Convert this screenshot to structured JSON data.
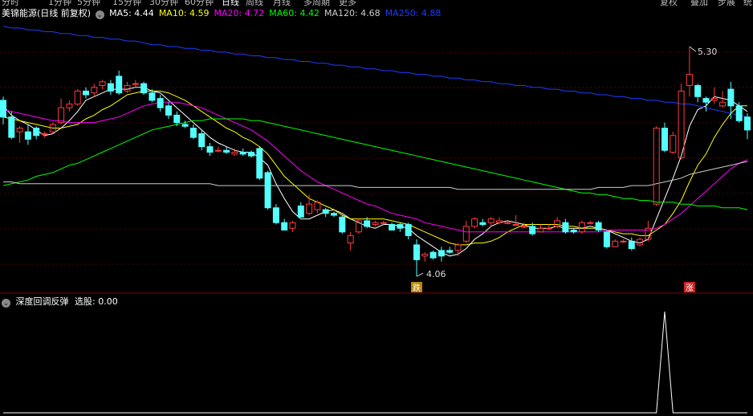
{
  "top_tabs": [
    "分时",
    "1分钟",
    "5分钟",
    "15分钟",
    "30分钟",
    "60分钟",
    "日线",
    "周线",
    "月线",
    "多周期",
    "更多"
  ],
  "active_tab": "日线",
  "top_buttons": [
    "复权",
    "叠加",
    "步展",
    "统"
  ],
  "stock_title": "美锦能源(日线 前复权)",
  "ma_legend": [
    {
      "label": "MA5: 4.44",
      "color": "#ffffff"
    },
    {
      "label": "MA10: 4.59",
      "color": "#ffff00"
    },
    {
      "label": "MA20: 4.72",
      "color": "#ff00ff"
    },
    {
      "label": "MA60: 4.42",
      "color": "#00ff00"
    },
    {
      "label": "MA120: 4.68",
      "color": "#cccccc"
    },
    {
      "label": "MA250: 4.88",
      "color": "#1c3cff"
    }
  ],
  "indicator_title": "深度回调反弹",
  "indicator_value": "选股: 0.00",
  "chart_data": {
    "type": "candlestick",
    "ylim": [
      4.0,
      5.43
    ],
    "high_annotation": "5.30",
    "low_annotation": "4.06",
    "markers": [
      "跌",
      "涨"
    ],
    "candles": [
      [
        5.01,
        4.92,
        5.03,
        4.88
      ],
      [
        4.92,
        4.81,
        4.95,
        4.8
      ],
      [
        4.84,
        4.86,
        4.87,
        4.78
      ],
      [
        4.84,
        4.8,
        4.88,
        4.77
      ],
      [
        4.86,
        4.82,
        4.87,
        4.8
      ],
      [
        4.83,
        4.83,
        4.84,
        4.81
      ],
      [
        4.84,
        4.88,
        4.89,
        4.83
      ],
      [
        4.89,
        4.97,
        5.02,
        4.88
      ],
      [
        4.97,
        4.99,
        5.01,
        4.95
      ],
      [
        4.99,
        5.06,
        5.07,
        4.98
      ],
      [
        5.06,
        5.04,
        5.08,
        5.02
      ],
      [
        5.05,
        5.08,
        5.1,
        5.03
      ],
      [
        5.09,
        5.11,
        5.12,
        5.07
      ],
      [
        5.1,
        5.06,
        5.12,
        5.04
      ],
      [
        5.14,
        5.05,
        5.17,
        5.04
      ],
      [
        5.06,
        5.09,
        5.11,
        5.05
      ],
      [
        5.1,
        5.1,
        5.12,
        5.08
      ],
      [
        5.1,
        5.05,
        5.11,
        5.04
      ],
      [
        5.05,
        5.01,
        5.07,
        5.0
      ],
      [
        5.02,
        4.97,
        5.04,
        4.95
      ],
      [
        4.98,
        4.93,
        5.0,
        4.91
      ],
      [
        4.93,
        4.89,
        4.95,
        4.87
      ],
      [
        4.88,
        4.87,
        4.9,
        4.86
      ],
      [
        4.86,
        4.81,
        4.88,
        4.8
      ],
      [
        4.83,
        4.76,
        4.85,
        4.74
      ],
      [
        4.76,
        4.73,
        4.78,
        4.71
      ],
      [
        4.74,
        4.74,
        4.76,
        4.73
      ],
      [
        4.74,
        4.73,
        4.76,
        4.72
      ],
      [
        4.72,
        4.73,
        4.75,
        4.71
      ],
      [
        4.73,
        4.72,
        4.75,
        4.71
      ],
      [
        4.73,
        4.71,
        4.74,
        4.7
      ],
      [
        4.75,
        4.59,
        4.76,
        4.58
      ],
      [
        4.62,
        4.43,
        4.63,
        4.42
      ],
      [
        4.43,
        4.35,
        4.45,
        4.34
      ],
      [
        4.35,
        4.31,
        4.37,
        4.31
      ],
      [
        4.32,
        4.35,
        4.36,
        4.3
      ],
      [
        4.44,
        4.38,
        4.46,
        4.38
      ],
      [
        4.4,
        4.45,
        4.5,
        4.39
      ],
      [
        4.42,
        4.46,
        4.47,
        4.4
      ],
      [
        4.42,
        4.4,
        4.43,
        4.38
      ],
      [
        4.4,
        4.39,
        4.41,
        4.38
      ],
      [
        4.38,
        4.3,
        4.39,
        4.29
      ],
      [
        4.24,
        4.28,
        4.3,
        4.2
      ],
      [
        4.3,
        4.36,
        4.37,
        4.29
      ],
      [
        4.36,
        4.33,
        4.38,
        4.32
      ],
      [
        4.34,
        4.35,
        4.36,
        4.33
      ],
      [
        4.35,
        4.35,
        4.36,
        4.34
      ],
      [
        4.34,
        4.31,
        4.35,
        4.31
      ],
      [
        4.34,
        4.32,
        4.35,
        4.3
      ],
      [
        4.34,
        4.28,
        4.35,
        4.26
      ],
      [
        4.23,
        4.15,
        4.26,
        4.06
      ],
      [
        4.17,
        4.18,
        4.19,
        4.14
      ],
      [
        4.19,
        4.16,
        4.2,
        4.15
      ],
      [
        4.2,
        4.17,
        4.22,
        4.14
      ],
      [
        4.2,
        4.19,
        4.22,
        4.18
      ],
      [
        4.2,
        4.23,
        4.24,
        4.17
      ],
      [
        4.25,
        4.33,
        4.36,
        4.24
      ],
      [
        4.33,
        4.37,
        4.38,
        4.32
      ],
      [
        4.35,
        4.34,
        4.37,
        4.33
      ],
      [
        4.35,
        4.37,
        4.38,
        4.33
      ],
      [
        4.35,
        4.36,
        4.38,
        4.34
      ],
      [
        4.35,
        4.35,
        4.36,
        4.34
      ],
      [
        4.34,
        4.34,
        4.39,
        4.34
      ],
      [
        4.33,
        4.33,
        4.35,
        4.32
      ],
      [
        4.33,
        4.29,
        4.35,
        4.28
      ],
      [
        4.3,
        4.32,
        4.34,
        4.3
      ],
      [
        4.32,
        4.32,
        4.34,
        4.31
      ],
      [
        4.33,
        4.36,
        4.38,
        4.32
      ],
      [
        4.35,
        4.3,
        4.37,
        4.29
      ],
      [
        4.31,
        4.3,
        4.32,
        4.29
      ],
      [
        4.3,
        4.35,
        4.36,
        4.29
      ],
      [
        4.35,
        4.35,
        4.36,
        4.34
      ],
      [
        4.35,
        4.31,
        4.36,
        4.3
      ],
      [
        4.3,
        4.22,
        4.31,
        4.21
      ],
      [
        4.22,
        4.25,
        4.26,
        4.22
      ],
      [
        4.25,
        4.25,
        4.26,
        4.24
      ],
      [
        4.25,
        4.21,
        4.27,
        4.2
      ],
      [
        4.23,
        4.26,
        4.27,
        4.22
      ],
      [
        4.26,
        4.32,
        4.36,
        4.25
      ],
      [
        4.45,
        4.86,
        4.87,
        4.44
      ],
      [
        4.86,
        4.74,
        4.89,
        4.73
      ],
      [
        4.73,
        4.82,
        4.84,
        4.72
      ],
      [
        4.7,
        5.06,
        5.1,
        4.69
      ],
      [
        5.09,
        5.15,
        5.3,
        5.03
      ],
      [
        5.09,
        5.03,
        5.1,
        5.0
      ],
      [
        5.02,
        5.0,
        5.03,
        4.95
      ],
      [
        5.01,
        5.02,
        5.08,
        4.99
      ],
      [
        4.98,
        5.0,
        5.06,
        4.97
      ],
      [
        5.07,
        4.98,
        5.11,
        4.91
      ],
      [
        4.98,
        4.9,
        5.0,
        4.89
      ],
      [
        4.92,
        4.85,
        4.94,
        4.8
      ]
    ],
    "ma_lines": {
      "MA5": [
        4.98,
        4.93,
        4.9,
        4.88,
        4.85,
        4.82,
        4.83,
        4.86,
        4.9,
        4.95,
        5.01,
        5.03,
        5.05,
        5.07,
        5.07,
        5.07,
        5.08,
        5.08,
        5.06,
        5.05,
        5.01,
        4.97,
        4.93,
        4.89,
        4.85,
        4.81,
        4.78,
        4.76,
        4.74,
        4.73,
        4.73,
        4.7,
        4.66,
        4.56,
        4.48,
        4.41,
        4.37,
        4.37,
        4.39,
        4.41,
        4.42,
        4.4,
        4.37,
        4.35,
        4.33,
        4.32,
        4.34,
        4.34,
        4.33,
        4.32,
        4.28,
        4.25,
        4.22,
        4.19,
        4.17,
        4.18,
        4.21,
        4.26,
        4.29,
        4.33,
        4.35,
        4.36,
        4.35,
        4.34,
        4.32,
        4.32,
        4.32,
        4.33,
        4.32,
        4.32,
        4.32,
        4.33,
        4.32,
        4.31,
        4.29,
        4.27,
        4.25,
        4.24,
        4.26,
        4.37,
        4.48,
        4.59,
        4.71,
        4.87,
        4.96,
        4.98,
        5.03,
        5.02,
        5.01,
        4.98,
        4.95
      ],
      "MA10": [
        4.92,
        4.91,
        4.9,
        4.89,
        4.88,
        4.87,
        4.86,
        4.86,
        4.87,
        4.88,
        4.91,
        4.93,
        4.96,
        4.98,
        5.01,
        5.04,
        5.05,
        5.06,
        5.06,
        5.06,
        5.05,
        5.03,
        5.01,
        4.98,
        4.95,
        4.92,
        4.89,
        4.86,
        4.84,
        4.81,
        4.79,
        4.76,
        4.72,
        4.66,
        4.6,
        4.56,
        4.52,
        4.48,
        4.46,
        4.44,
        4.42,
        4.39,
        4.37,
        4.37,
        4.37,
        4.37,
        4.37,
        4.36,
        4.35,
        4.34,
        4.32,
        4.3,
        4.28,
        4.26,
        4.24,
        4.23,
        4.23,
        4.24,
        4.24,
        4.25,
        4.27,
        4.3,
        4.32,
        4.34,
        4.34,
        4.34,
        4.34,
        4.34,
        4.33,
        4.33,
        4.32,
        4.32,
        4.32,
        4.31,
        4.3,
        4.29,
        4.29,
        4.28,
        4.28,
        4.31,
        4.34,
        4.4,
        4.47,
        4.57,
        4.66,
        4.72,
        4.81,
        4.88,
        4.94,
        4.98,
        4.98
      ],
      "MA20": [
        4.96,
        4.95,
        4.94,
        4.93,
        4.92,
        4.91,
        4.9,
        4.9,
        4.89,
        4.89,
        4.89,
        4.89,
        4.9,
        4.91,
        4.92,
        4.94,
        4.96,
        4.98,
        4.99,
        5.0,
        5.0,
        5.0,
        4.99,
        4.98,
        4.97,
        4.95,
        4.93,
        4.91,
        4.89,
        4.87,
        4.85,
        4.82,
        4.79,
        4.75,
        4.71,
        4.67,
        4.63,
        4.6,
        4.57,
        4.55,
        4.53,
        4.51,
        4.49,
        4.47,
        4.45,
        4.44,
        4.42,
        4.4,
        4.39,
        4.38,
        4.37,
        4.35,
        4.34,
        4.33,
        4.32,
        4.31,
        4.3,
        4.3,
        4.3,
        4.3,
        4.3,
        4.3,
        4.3,
        4.3,
        4.3,
        4.3,
        4.3,
        4.3,
        4.3,
        4.3,
        4.3,
        4.3,
        4.3,
        4.31,
        4.31,
        4.31,
        4.31,
        4.31,
        4.31,
        4.32,
        4.34,
        4.37,
        4.4,
        4.44,
        4.48,
        4.52,
        4.56,
        4.6,
        4.64,
        4.67,
        4.69
      ],
      "MA60": [
        4.55,
        4.56,
        4.57,
        4.58,
        4.6,
        4.61,
        4.62,
        4.64,
        4.66,
        4.67,
        4.69,
        4.71,
        4.73,
        4.75,
        4.77,
        4.79,
        4.81,
        4.83,
        4.85,
        4.86,
        4.87,
        4.88,
        4.89,
        4.9,
        4.9,
        4.91,
        4.91,
        4.91,
        4.91,
        4.91,
        4.9,
        4.9,
        4.89,
        4.88,
        4.87,
        4.86,
        4.85,
        4.84,
        4.83,
        4.82,
        4.81,
        4.8,
        4.79,
        4.78,
        4.77,
        4.76,
        4.75,
        4.74,
        4.73,
        4.72,
        4.71,
        4.7,
        4.69,
        4.68,
        4.67,
        4.66,
        4.65,
        4.64,
        4.63,
        4.62,
        4.61,
        4.6,
        4.59,
        4.58,
        4.57,
        4.56,
        4.55,
        4.54,
        4.53,
        4.52,
        4.51,
        4.51,
        4.5,
        4.5,
        4.49,
        4.48,
        4.48,
        4.47,
        4.47,
        4.46,
        4.46,
        4.46,
        4.45,
        4.45,
        4.44,
        4.44,
        4.44,
        4.43,
        4.43,
        4.43,
        4.42
      ],
      "MA120": [
        4.57,
        4.57,
        4.56,
        4.56,
        4.56,
        4.56,
        4.56,
        4.56,
        4.56,
        4.56,
        4.56,
        4.56,
        4.56,
        4.56,
        4.56,
        4.56,
        4.56,
        4.56,
        4.56,
        4.56,
        4.56,
        4.56,
        4.56,
        4.56,
        4.56,
        4.56,
        4.55,
        4.55,
        4.55,
        4.55,
        4.55,
        4.55,
        4.55,
        4.55,
        4.55,
        4.55,
        4.55,
        4.55,
        4.55,
        4.55,
        4.55,
        4.55,
        4.55,
        4.54,
        4.54,
        4.54,
        4.54,
        4.54,
        4.54,
        4.54,
        4.54,
        4.54,
        4.54,
        4.54,
        4.54,
        4.53,
        4.53,
        4.53,
        4.53,
        4.53,
        4.53,
        4.53,
        4.53,
        4.53,
        4.53,
        4.53,
        4.53,
        4.53,
        4.53,
        4.53,
        4.53,
        4.53,
        4.54,
        4.54,
        4.54,
        4.54,
        4.55,
        4.55,
        4.55,
        4.56,
        4.57,
        4.58,
        4.59,
        4.61,
        4.62,
        4.63,
        4.64,
        4.65,
        4.66,
        4.67,
        4.68
      ],
      "MA250": [
        5.41,
        5.4,
        5.4,
        5.39,
        5.39,
        5.38,
        5.38,
        5.37,
        5.37,
        5.36,
        5.36,
        5.35,
        5.35,
        5.34,
        5.34,
        5.33,
        5.33,
        5.32,
        5.31,
        5.31,
        5.3,
        5.3,
        5.29,
        5.29,
        5.28,
        5.28,
        5.27,
        5.27,
        5.26,
        5.26,
        5.25,
        5.25,
        5.24,
        5.24,
        5.23,
        5.23,
        5.22,
        5.22,
        5.21,
        5.21,
        5.2,
        5.2,
        5.19,
        5.19,
        5.18,
        5.18,
        5.17,
        5.17,
        5.16,
        5.16,
        5.15,
        5.15,
        5.14,
        5.14,
        5.13,
        5.13,
        5.12,
        5.12,
        5.11,
        5.11,
        5.1,
        5.1,
        5.09,
        5.09,
        5.08,
        5.08,
        5.07,
        5.07,
        5.06,
        5.06,
        5.05,
        5.05,
        5.04,
        5.04,
        5.03,
        5.03,
        5.02,
        5.02,
        5.01,
        5.01,
        5.0,
        5.0,
        4.99,
        4.99,
        4.98,
        4.97,
        4.96,
        4.95,
        4.94,
        4.93,
        4.92
      ]
    },
    "ma_colors": {
      "MA5": "#ffffff",
      "MA10": "#ffff00",
      "MA20": "#ff00ff",
      "MA60": "#00ff00",
      "MA120": "#cccccc",
      "MA250": "#1c3cff"
    },
    "up_color": "#ff3b3b",
    "down_color": "#54ffff",
    "indicator_signal": [
      0,
      0,
      0,
      0,
      0,
      0,
      0,
      0,
      0,
      0,
      0,
      0,
      0,
      0,
      0,
      0,
      0,
      0,
      0,
      0,
      0,
      0,
      0,
      0,
      0,
      0,
      0,
      0,
      0,
      0,
      0,
      0,
      0,
      0,
      0,
      0,
      0,
      0,
      0,
      0,
      0,
      0,
      0,
      0,
      0,
      0,
      0,
      0,
      0,
      0,
      0,
      0,
      0,
      0,
      0,
      0,
      0,
      0,
      0,
      0,
      0,
      0,
      0,
      0,
      0,
      0,
      0,
      0,
      0,
      0,
      0,
      0,
      0,
      0,
      0,
      0,
      0,
      0,
      0,
      0,
      1,
      0,
      0,
      0,
      0,
      0,
      0,
      0,
      0,
      0,
      0
    ]
  }
}
